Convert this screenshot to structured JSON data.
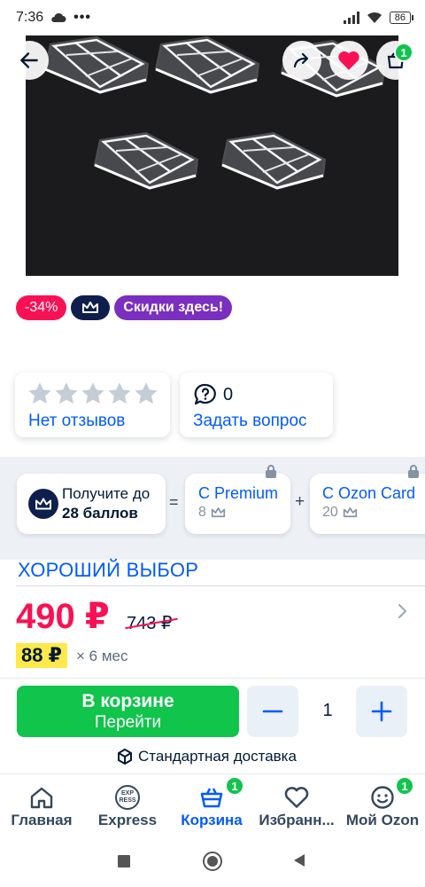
{
  "status_bar": {
    "time": "7:36",
    "dots": "•••",
    "battery": "86"
  },
  "badges": {
    "cart_count": "1",
    "profile_count": "1"
  },
  "discount_tag": "-34%",
  "sale_tag": "Скидки здесь!",
  "reviews": {
    "none_label": "Нет отзывов",
    "questions_count": "0",
    "ask_label": "Задать вопрос"
  },
  "points": {
    "get_line1": "Получите до",
    "get_line2": "28 баллов",
    "equals": "=",
    "plus": "+",
    "premium_title": "С Premium",
    "premium_value": "8",
    "card_title": "С Ozon Card",
    "card_value": "20"
  },
  "good_choice": "ХОРОШИЙ ВЫБОР",
  "price": {
    "current": "490 ₽",
    "old": "743 ₽",
    "installment": "88 ₽",
    "months": "× 6 мес"
  },
  "cart_button": {
    "line1": "В корзине",
    "line2": "Перейти"
  },
  "quantity": "1",
  "delivery": "Стандартная доставка",
  "tabs": [
    {
      "label": "Главная"
    },
    {
      "label": "Express",
      "icon_text": "EXP RESS"
    },
    {
      "label": "Корзина"
    },
    {
      "label": "Избранн..."
    },
    {
      "label": "Мой Ozon"
    }
  ],
  "colors": {
    "accent": "#005bff",
    "price": "#f91155",
    "green": "#10c44c",
    "purple": "#7b2fc0"
  }
}
